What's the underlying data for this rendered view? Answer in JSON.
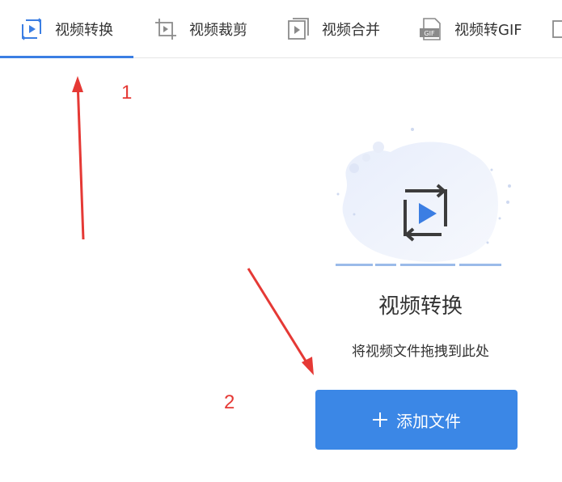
{
  "tabs": [
    {
      "label": "视频转换",
      "icon": "video-convert-icon",
      "active": true
    },
    {
      "label": "视频裁剪",
      "icon": "video-crop-icon",
      "active": false
    },
    {
      "label": "视频合并",
      "icon": "video-merge-icon",
      "active": false
    },
    {
      "label": "视频转GIF",
      "icon": "gif-icon",
      "active": false
    }
  ],
  "gif_badge": "GIF",
  "annotations": {
    "one": "1",
    "two": "2"
  },
  "drop_area": {
    "title": "视频转换",
    "hint": "将视频文件拖拽到此处",
    "button_label": "添加文件"
  },
  "colors": {
    "accent": "#3b7ee3",
    "button": "#3b87e6",
    "annotation": "#e53935"
  }
}
